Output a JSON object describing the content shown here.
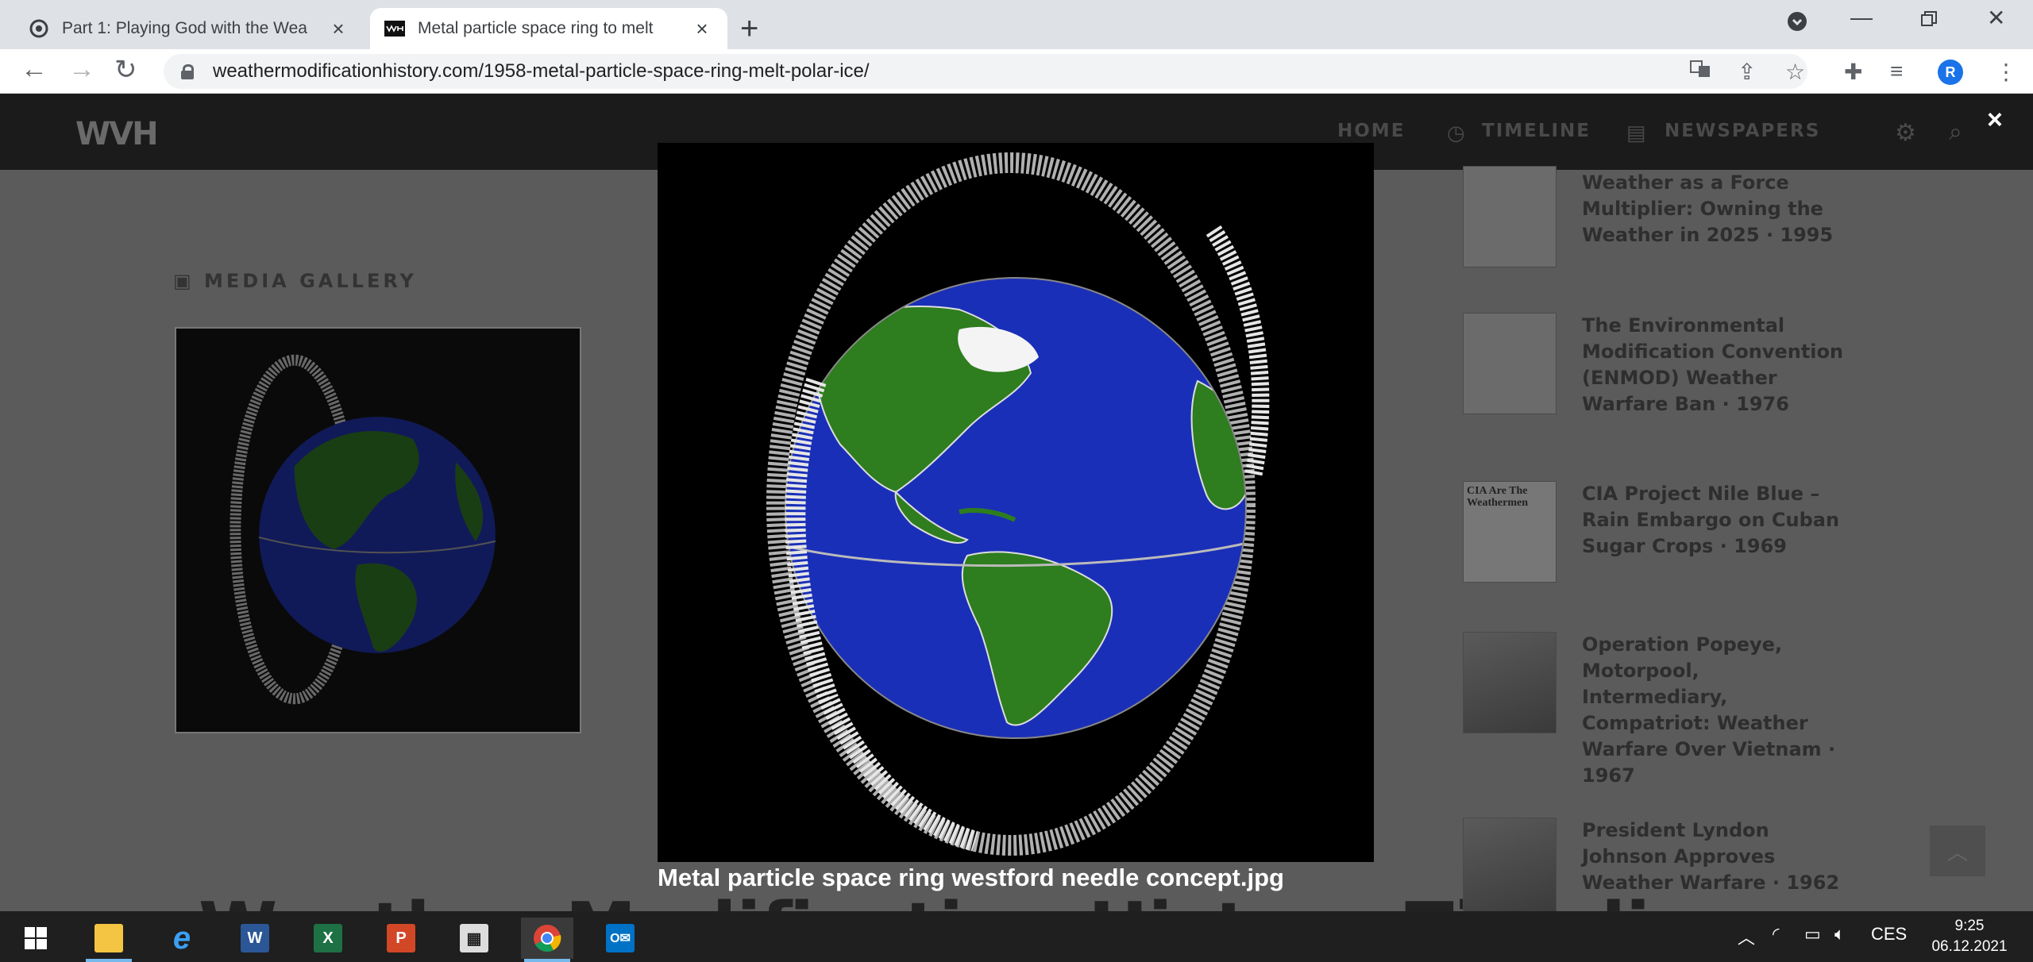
{
  "browser": {
    "tabs": [
      {
        "title": "Part 1: Playing God with the Wea",
        "active": false
      },
      {
        "title": "Metal particle space ring to melt",
        "active": true
      }
    ],
    "new_tab": "+",
    "url": "weathermodificationhistory.com/1958-metal-particle-space-ring-melt-polar-ice/",
    "profile_initial": "R"
  },
  "site": {
    "logo": "WVH",
    "nav": {
      "home": "HOME",
      "timeline": "TIMELINE",
      "newspapers": "NEWSPAPERS"
    },
    "media_gallery_label": "MEDIA GALLERY",
    "heading_partial": "Weather Modification History Timeline",
    "related": [
      {
        "title": "Weather as a Force Multiplier: Owning the Weather in 2025 · 1995"
      },
      {
        "title": "The Environmental Modification Convention (ENMOD) Weather Warfare Ban · 1976"
      },
      {
        "title": "CIA Project Nile Blue – Rain Embargo on Cuban Sugar Crops · 1969"
      },
      {
        "title": "Operation Popeye, Motorpool, Intermediary, Compatriot: Weather Warfare Over Vietnam · 1967"
      },
      {
        "title": "President Lyndon Johnson Approves Weather Warfare · 1962"
      }
    ],
    "newspaper_thumb_text": "CIA Are The Weathermen"
  },
  "lightbox": {
    "caption": "Metal particle space ring westford needle concept.jpg",
    "close": "×"
  },
  "taskbar": {
    "language": "CES",
    "time": "9:25",
    "date": "06.12.2021"
  },
  "colors": {
    "ocean": "#1a2fb8",
    "land": "#2e7d1e",
    "tab_strip": "#dee1e6",
    "taskbar": "#1f1f1f"
  }
}
